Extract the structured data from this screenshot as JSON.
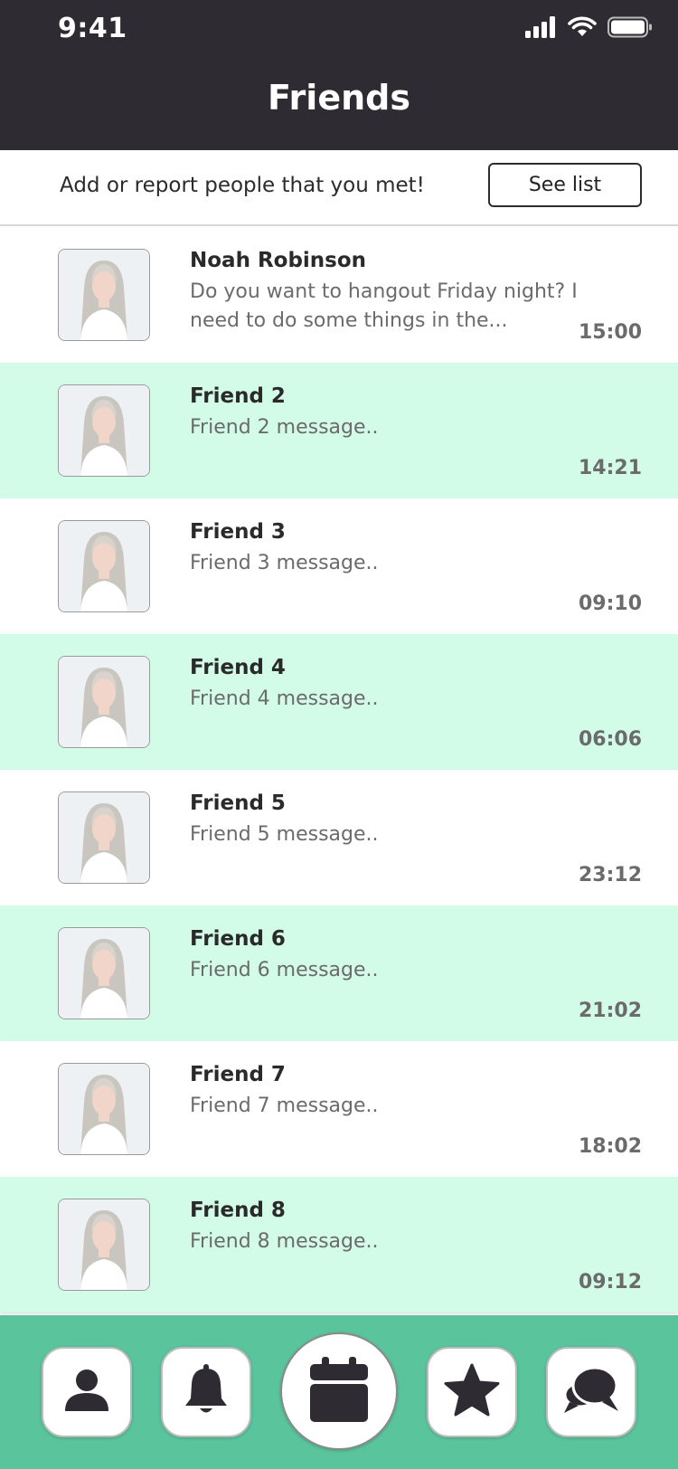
{
  "status": {
    "time": "9:41"
  },
  "header": {
    "title": "Friends"
  },
  "banner": {
    "text": "Add or report people that you met!",
    "button_label": "See list"
  },
  "conversations": [
    {
      "name": "Noah Robinson",
      "message": "Do you want to hangout Friday night? I need to do some things in the...",
      "time": "15:00"
    },
    {
      "name": "Friend 2",
      "message": "Friend 2 message..",
      "time": "14:21"
    },
    {
      "name": "Friend 3",
      "message": "Friend 3 message..",
      "time": "09:10"
    },
    {
      "name": "Friend 4",
      "message": "Friend 4 message..",
      "time": "06:06"
    },
    {
      "name": "Friend 5",
      "message": "Friend 5 message..",
      "time": "23:12"
    },
    {
      "name": "Friend 6",
      "message": "Friend 6 message..",
      "time": "21:02"
    },
    {
      "name": "Friend 7",
      "message": "Friend 7 message..",
      "time": "18:02"
    },
    {
      "name": "Friend 8",
      "message": "Friend 8 message..",
      "time": "09:12"
    }
  ],
  "nav": {
    "items": [
      {
        "icon": "user-icon"
      },
      {
        "icon": "bell-icon"
      },
      {
        "icon": "calendar-icon"
      },
      {
        "icon": "star-icon"
      },
      {
        "icon": "chat-bubbles-icon"
      }
    ]
  },
  "colors": {
    "header_bg": "#2e2c32",
    "mint_row": "#d2fbe8",
    "nav_bg": "#5ac49d"
  }
}
